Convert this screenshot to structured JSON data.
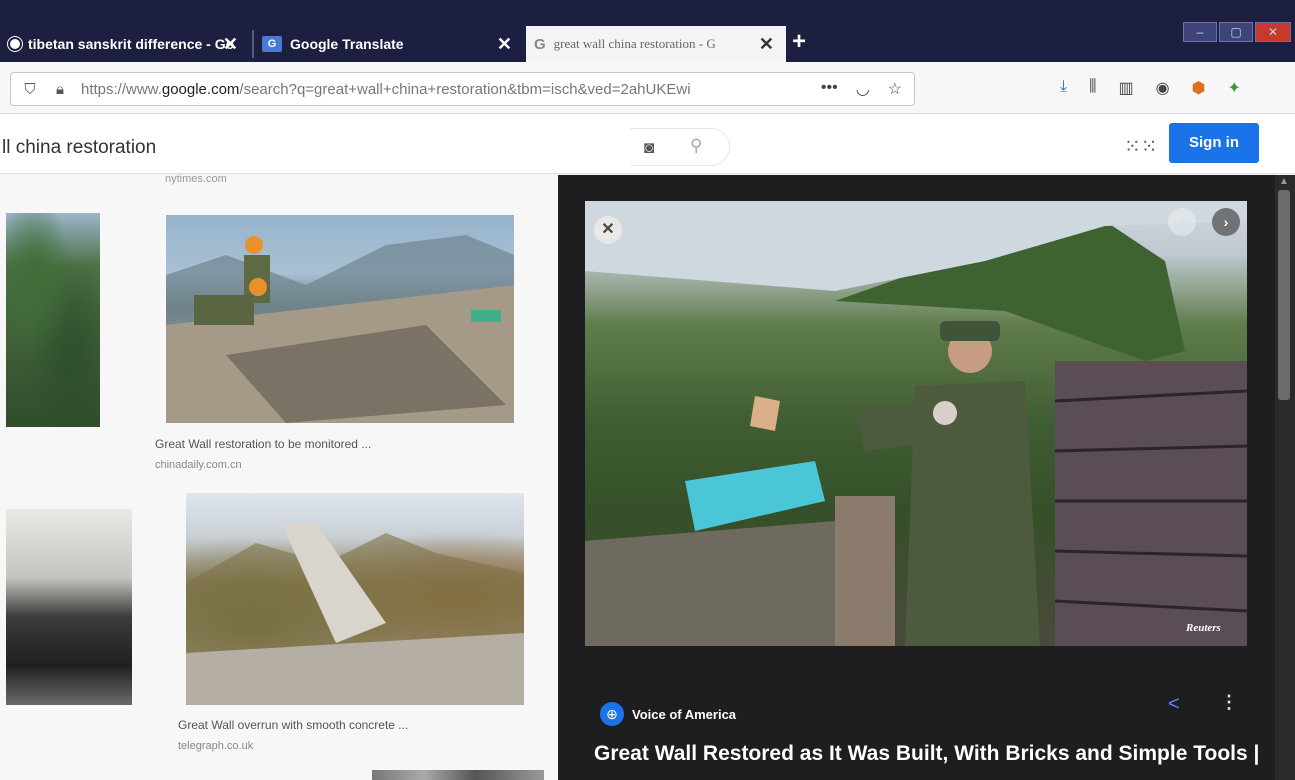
{
  "tabs": [
    {
      "title": "tibetan sanskrit difference - Go",
      "close": "✕",
      "favicon": "globe-icon",
      "active": false
    },
    {
      "title": "Google Translate",
      "close": "✕",
      "favicon": "google-translate-icon",
      "active": false
    },
    {
      "title": "great wall china restoration - G",
      "close": "✕",
      "favicon": "google-g-icon",
      "active": true
    }
  ],
  "new_tab_label": "+",
  "url": {
    "prefix": "https://www.",
    "domain": "google.com",
    "rest": "/search?q=great+wall+china+restoration&tbm=isch&ved=2ahUKEwi"
  },
  "search": {
    "query": "ll china restoration"
  },
  "header": {
    "signin_label": "Sign in"
  },
  "results": {
    "top_source": "nytimes.com",
    "items": [
      {
        "title": "Great Wall restoration to be monitored ...",
        "domain": "chinadaily.com.cn"
      },
      {
        "title": "Great Wall overrun with smooth concrete ...",
        "domain": "telegraph.co.uk"
      }
    ]
  },
  "preview": {
    "credit": "Reuters",
    "source": "Voice of America",
    "title": "Great Wall Restored as It Was Built, With Bricks and Simple Tools |"
  },
  "colors": {
    "tabstrip": "#1c1f3f",
    "signin": "#1a73e8",
    "preview_bg": "#1e1e20"
  }
}
